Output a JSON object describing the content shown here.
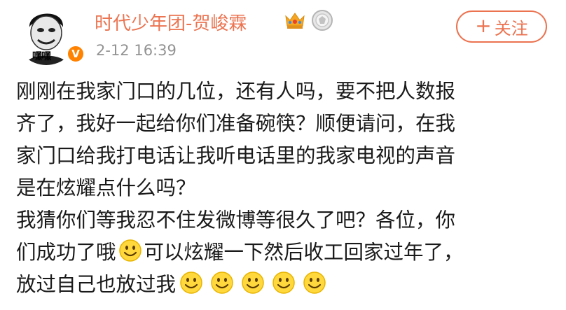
{
  "post": {
    "author": {
      "name": "时代少年团-贺峻霖",
      "avatar_caption": "嘿嘿",
      "verified_badge": "V"
    },
    "timestamp": "2-12 16:39",
    "follow_label": "关注",
    "follow_icon": "plus-icon",
    "content": {
      "line1": "刚刚在我家门口的几位，还有人吗，要不把人数报",
      "line2": "齐了，我好一起给你们准备碗筷？顺便请问，在我",
      "line3": "家门口给我打电话让我听电话里的我家电视的声音",
      "line4": "是在炫耀点什么吗？",
      "line5": "我猜你们等我忍不住发微博等很久了吧？各位，你",
      "line6a": "们成功了哦",
      "line6b": "可以炫耀一下然后收工回家过年了，",
      "line7": "放过自己也放过我"
    }
  },
  "colors": {
    "username": "#eb7350",
    "follow_accent": "#eb7350",
    "timestamp": "#939393",
    "text": "#1a1a1a",
    "verified_badge": "#ff8200"
  }
}
